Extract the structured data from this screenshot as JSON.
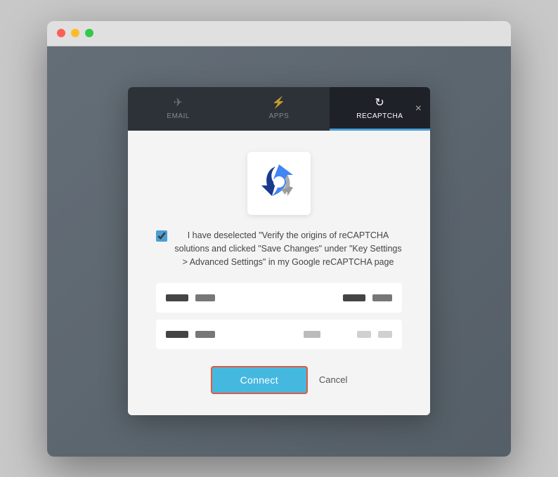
{
  "browser": {
    "traffic_lights": [
      "close",
      "minimize",
      "maximize"
    ]
  },
  "modal": {
    "tabs": [
      {
        "id": "email",
        "label": "EMAIL",
        "icon": "✈",
        "active": false
      },
      {
        "id": "apps",
        "label": "APPS",
        "icon": "⚡",
        "active": false
      },
      {
        "id": "recaptcha",
        "label": "RECAPTCHA",
        "icon": "↻",
        "active": true
      }
    ],
    "close_label": "×",
    "checkbox_text": "I have deselected \"Verify the origins of reCAPTCHA solutions and clicked \"Save Changes\" under \"Key Settings > Advanced Settings\" in my Google reCAPTCHA page",
    "connect_label": "Connect",
    "cancel_label": "Cancel"
  }
}
